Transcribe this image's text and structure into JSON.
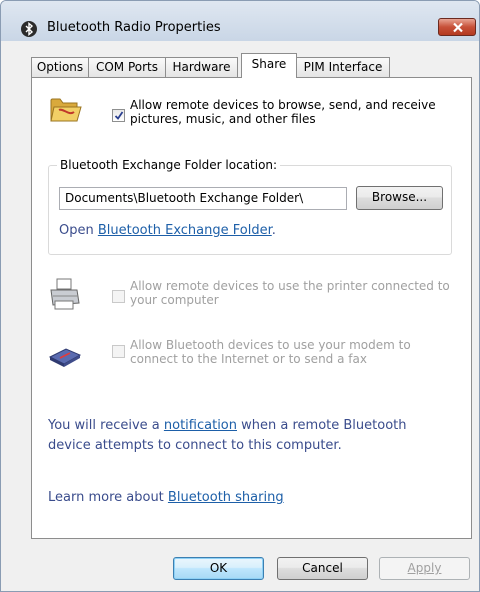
{
  "window": {
    "title": "Bluetooth Radio Properties"
  },
  "tabs": [
    {
      "label": "Options"
    },
    {
      "label": "COM Ports"
    },
    {
      "label": "Hardware"
    },
    {
      "label": "Share",
      "active": true
    },
    {
      "label": "PIM Interface"
    }
  ],
  "share": {
    "allow_files": {
      "checked": true,
      "line1": "Allow remote devices to browse, send, and receive",
      "line2": "pictures, music, and other files"
    },
    "folder_group": {
      "legend": "Bluetooth Exchange Folder location:",
      "path_value": "Documents\\Bluetooth Exchange Folder\\",
      "browse_label": "Browse...",
      "open_prefix": "Open ",
      "open_link": "Bluetooth Exchange Folder",
      "open_suffix": "."
    },
    "allow_printer": {
      "checked": false,
      "enabled": false,
      "line1": "Allow remote devices to use the printer connected to",
      "line2": "your computer"
    },
    "allow_modem": {
      "checked": false,
      "enabled": false,
      "line1": "Allow Bluetooth devices to use your modem to",
      "line2": "connect to the Internet or to send a fax"
    },
    "notification": {
      "line1_prefix": "You will receive a ",
      "link": "notification",
      "line1_suffix": " when a remote Bluetooth",
      "line2": "device attempts to connect to this computer."
    },
    "learn_more": {
      "prefix": "Learn more about ",
      "link": "Bluetooth sharing"
    }
  },
  "buttons": {
    "ok": "OK",
    "cancel": "Cancel",
    "apply": "Apply"
  },
  "colors": {
    "link": "#1d5fa8",
    "info_text": "#3a4c8c",
    "close_button": "#c75038"
  }
}
